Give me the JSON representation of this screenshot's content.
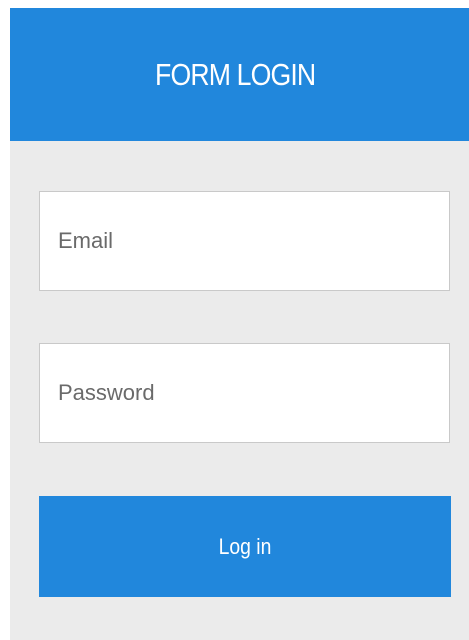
{
  "header": {
    "title": "FORM LOGIN"
  },
  "form": {
    "email": {
      "value": "",
      "placeholder": "Email"
    },
    "password": {
      "value": "",
      "placeholder": "Password"
    },
    "submit_label": "Log in"
  },
  "colors": {
    "accent": "#2187dc",
    "card_background": "#ebebeb",
    "field_background": "#ffffff",
    "field_border": "#c9c9c9",
    "header_text": "#ffffff"
  }
}
